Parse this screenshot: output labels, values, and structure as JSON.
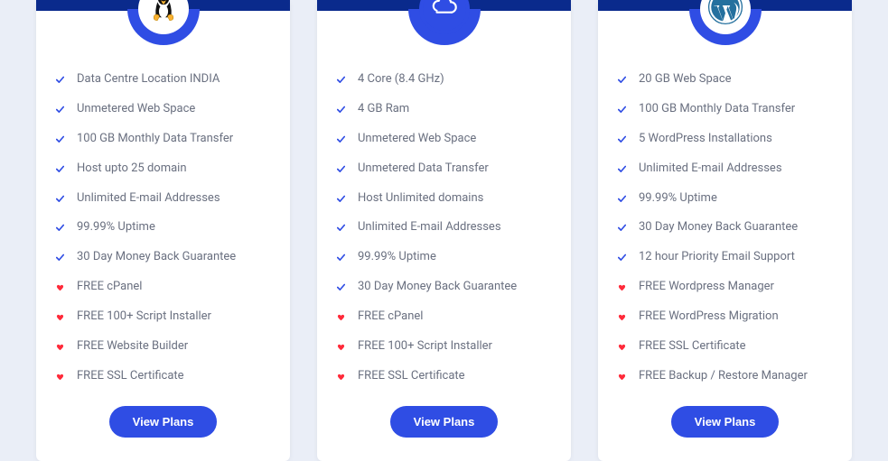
{
  "colors": {
    "accent": "#2f4de4",
    "check": "#2f4de4",
    "heart": "#ff2a3a",
    "band": "#0a2a8c",
    "pageBg": "#eaeef7",
    "wpBlue": "#24709e"
  },
  "buttonLabel": "View Plans",
  "plans": [
    {
      "icon": "linux-icon",
      "features": [
        {
          "marker": "check",
          "text": "Data Centre Location INDIA"
        },
        {
          "marker": "check",
          "text": "Unmetered Web Space"
        },
        {
          "marker": "check",
          "text": "100 GB Monthly Data Transfer"
        },
        {
          "marker": "check",
          "text": "Host upto 25 domain"
        },
        {
          "marker": "check",
          "text": "Unlimited E-mail Addresses"
        },
        {
          "marker": "check",
          "text": "99.99% Uptime"
        },
        {
          "marker": "check",
          "text": "30 Day Money Back Guarantee"
        },
        {
          "marker": "heart",
          "text": "FREE cPanel"
        },
        {
          "marker": "heart",
          "text": "FREE 100+ Script Installer"
        },
        {
          "marker": "heart",
          "text": "FREE Website Builder"
        },
        {
          "marker": "heart",
          "text": "FREE SSL Certificate"
        }
      ]
    },
    {
      "icon": "cloud-icon",
      "features": [
        {
          "marker": "check",
          "text": "4 Core (8.4 GHz)"
        },
        {
          "marker": "check",
          "text": "4 GB Ram"
        },
        {
          "marker": "check",
          "text": "Unmetered Web Space"
        },
        {
          "marker": "check",
          "text": "Unmetered Data Transfer"
        },
        {
          "marker": "check",
          "text": "Host Unlimited domains"
        },
        {
          "marker": "check",
          "text": "Unlimited E-mail Addresses"
        },
        {
          "marker": "check",
          "text": "99.99% Uptime"
        },
        {
          "marker": "check",
          "text": "30 Day Money Back Guarantee"
        },
        {
          "marker": "heart",
          "text": "FREE cPanel"
        },
        {
          "marker": "heart",
          "text": "FREE 100+ Script Installer"
        },
        {
          "marker": "heart",
          "text": "FREE SSL Certificate"
        }
      ]
    },
    {
      "icon": "wordpress-icon",
      "features": [
        {
          "marker": "check",
          "text": "20 GB Web Space"
        },
        {
          "marker": "check",
          "text": "100 GB Monthly Data Transfer"
        },
        {
          "marker": "check",
          "text": "5 WordPress Installations"
        },
        {
          "marker": "check",
          "text": "Unlimited E-mail Addresses"
        },
        {
          "marker": "check",
          "text": "99.99% Uptime"
        },
        {
          "marker": "check",
          "text": "30 Day Money Back Guarantee"
        },
        {
          "marker": "check",
          "text": "12 hour Priority Email Support"
        },
        {
          "marker": "heart",
          "text": "FREE Wordpress Manager"
        },
        {
          "marker": "heart",
          "text": "FREE WordPress Migration"
        },
        {
          "marker": "heart",
          "text": "FREE SSL Certificate"
        },
        {
          "marker": "heart",
          "text": "FREE Backup / Restore Manager"
        }
      ]
    }
  ]
}
